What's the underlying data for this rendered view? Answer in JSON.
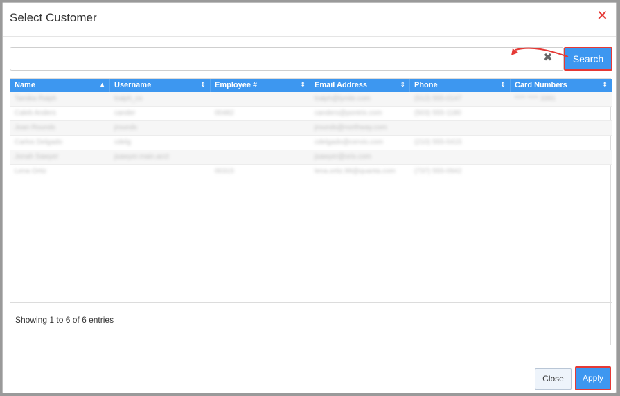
{
  "dialog": {
    "title": "Select Customer"
  },
  "search": {
    "placeholder": "",
    "value": "",
    "button_label": "Search"
  },
  "colors": {
    "accent": "#3d97f0",
    "highlight_outline": "#e53935",
    "close_x": "#e53935"
  },
  "table": {
    "columns": [
      "Name",
      "Username",
      "Employee #",
      "Email Address",
      "Phone",
      "Card Numbers"
    ],
    "rows": [
      [
        "Tamika Ralph",
        "tralph_cs",
        "",
        "tralph@lymbr.com",
        "(512) 555-0147",
        "**** **** 3391"
      ],
      [
        "Caleb Anders",
        "cander",
        "00482",
        "canders@pontrix.com",
        "(503) 555-1180",
        ""
      ],
      [
        "Joan Rounds",
        "jrounds",
        "",
        "jrounds@northway.com",
        "",
        ""
      ],
      [
        "Carlos Delgado",
        "cdelg",
        "",
        "cdelgado@cervio.com",
        "(210) 555-0415",
        ""
      ],
      [
        "Jonah Sawyer",
        "jsawyer.main.acct",
        "",
        "jsawyer@orix.com",
        "",
        ""
      ],
      [
        "Lena Ortiz",
        "",
        "00315",
        "lena.ortiz.99@quanta.com",
        "(737) 555-0942",
        ""
      ]
    ],
    "footer_text": "Showing 1 to 6 of 6 entries"
  },
  "footer": {
    "close_label": "Close",
    "apply_label": "Apply"
  },
  "icons": {
    "close": "close-icon",
    "clear": "clear-search-icon",
    "sort_asc": "sort-asc-icon",
    "sort_both": "sort-both-icon"
  }
}
